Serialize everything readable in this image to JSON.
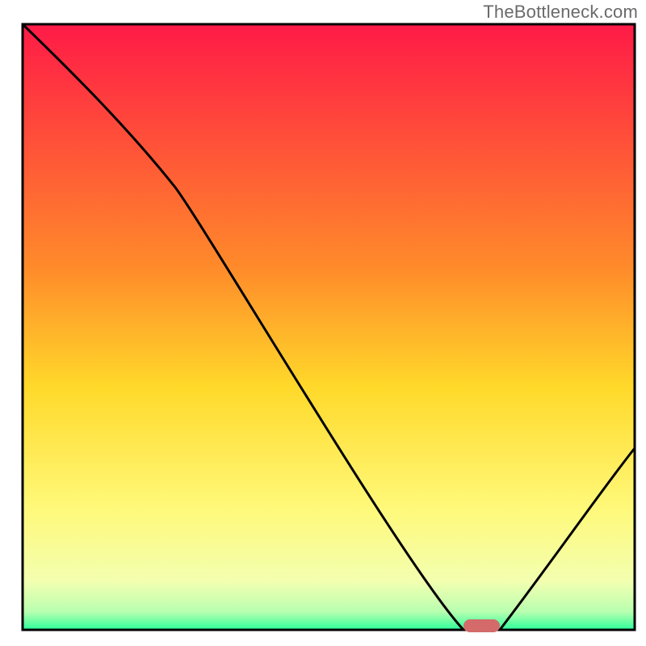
{
  "watermark": "TheBottleneck.com",
  "chart_data": {
    "type": "line",
    "title": "",
    "xlabel": "",
    "ylabel": "",
    "xlim": [
      0,
      100
    ],
    "ylim": [
      0,
      100
    ],
    "x": [
      0,
      25,
      72,
      78,
      100
    ],
    "series": [
      {
        "name": "curve",
        "values": [
          100,
          73,
          0,
          0,
          30
        ]
      }
    ],
    "minimum_marker": {
      "x_center": 75,
      "y": 0,
      "width_x": 6
    },
    "gradient_stops": [
      {
        "pct": 0,
        "color": "#ff1a47"
      },
      {
        "pct": 40,
        "color": "#ff8a2a"
      },
      {
        "pct": 60,
        "color": "#ffd92a"
      },
      {
        "pct": 80,
        "color": "#fff97a"
      },
      {
        "pct": 92,
        "color": "#f3ffb0"
      },
      {
        "pct": 97,
        "color": "#b9ffb0"
      },
      {
        "pct": 100,
        "color": "#2bff9a"
      }
    ],
    "marker_color": "#d46a6a",
    "curve_color": "#000000",
    "frame_color": "#000000"
  }
}
